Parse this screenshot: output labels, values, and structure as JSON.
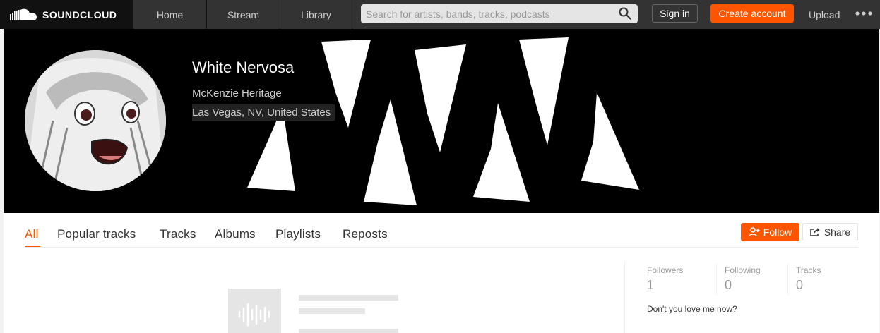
{
  "app": {
    "logo_text": "SOUNDCLOUD"
  },
  "nav": {
    "home": "Home",
    "stream": "Stream",
    "library": "Library",
    "search_placeholder": "Search for artists, bands, tracks, podcasts",
    "search_value": "",
    "sign_in": "Sign in",
    "create_account": "Create account",
    "upload": "Upload",
    "more_icon": "more-dots-icon"
  },
  "profile": {
    "username": "White Nervosa",
    "full_name": "McKenzie Heritage",
    "location": "Las Vegas, NV, United States",
    "bio": "Don't you love me now?"
  },
  "tabs": [
    {
      "label": "All",
      "active": true
    },
    {
      "label": "Popular tracks",
      "active": false
    },
    {
      "label": "Tracks",
      "active": false
    },
    {
      "label": "Albums",
      "active": false
    },
    {
      "label": "Playlists",
      "active": false
    },
    {
      "label": "Reposts",
      "active": false
    }
  ],
  "actions": {
    "follow": "Follow",
    "share": "Share"
  },
  "stats": [
    {
      "label": "Followers",
      "value": "1"
    },
    {
      "label": "Following",
      "value": "0"
    },
    {
      "label": "Tracks",
      "value": "0"
    }
  ],
  "colors": {
    "accent": "#ff5500",
    "topbar": "#333333",
    "logo_bg": "#111111"
  }
}
